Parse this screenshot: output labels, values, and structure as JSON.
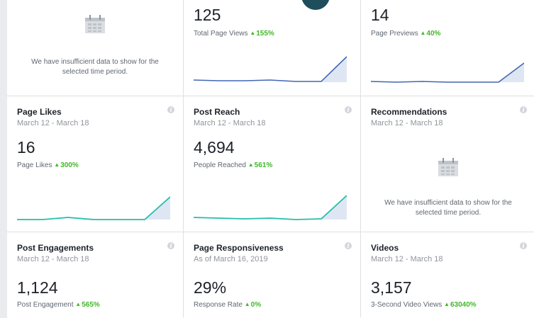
{
  "colors": {
    "blue_line": "#4267b2",
    "teal_line": "#22bfa9",
    "growth_green": "#42b72a"
  },
  "cards": {
    "top_left": {
      "insufficient_line1": "We have insufficient data to show for the",
      "insufficient_line2": "selected time period."
    },
    "page_views": {
      "value": "125",
      "label": "Total Page Views",
      "change": "155%"
    },
    "page_previews": {
      "value": "14",
      "label": "Page Previews",
      "change": "40%"
    },
    "page_likes": {
      "title": "Page Likes",
      "date_range": "March 12 - March 18",
      "value": "16",
      "label": "Page Likes",
      "change": "300%"
    },
    "post_reach": {
      "title": "Post Reach",
      "date_range": "March 12 - March 18",
      "value": "4,694",
      "label": "People Reached",
      "change": "561%"
    },
    "recommendations": {
      "title": "Recommendations",
      "date_range": "March 12 - March 18",
      "insufficient_line1": "We have insufficient data to show for the",
      "insufficient_line2": "selected time period."
    },
    "post_engagements": {
      "title": "Post Engagements",
      "date_range": "March 12 - March 18",
      "value": "1,124",
      "label": "Post Engagement",
      "change": "565%"
    },
    "page_responsiveness": {
      "title": "Page Responsiveness",
      "date_range": "As of March 16, 2019",
      "value": "29%",
      "label": "Response Rate",
      "change": "0%"
    },
    "videos": {
      "title": "Videos",
      "date_range": "March 12 - March 18",
      "value": "3,157",
      "label": "3-Second Video Views",
      "change": "63040%"
    }
  },
  "info_glyph": "i"
}
